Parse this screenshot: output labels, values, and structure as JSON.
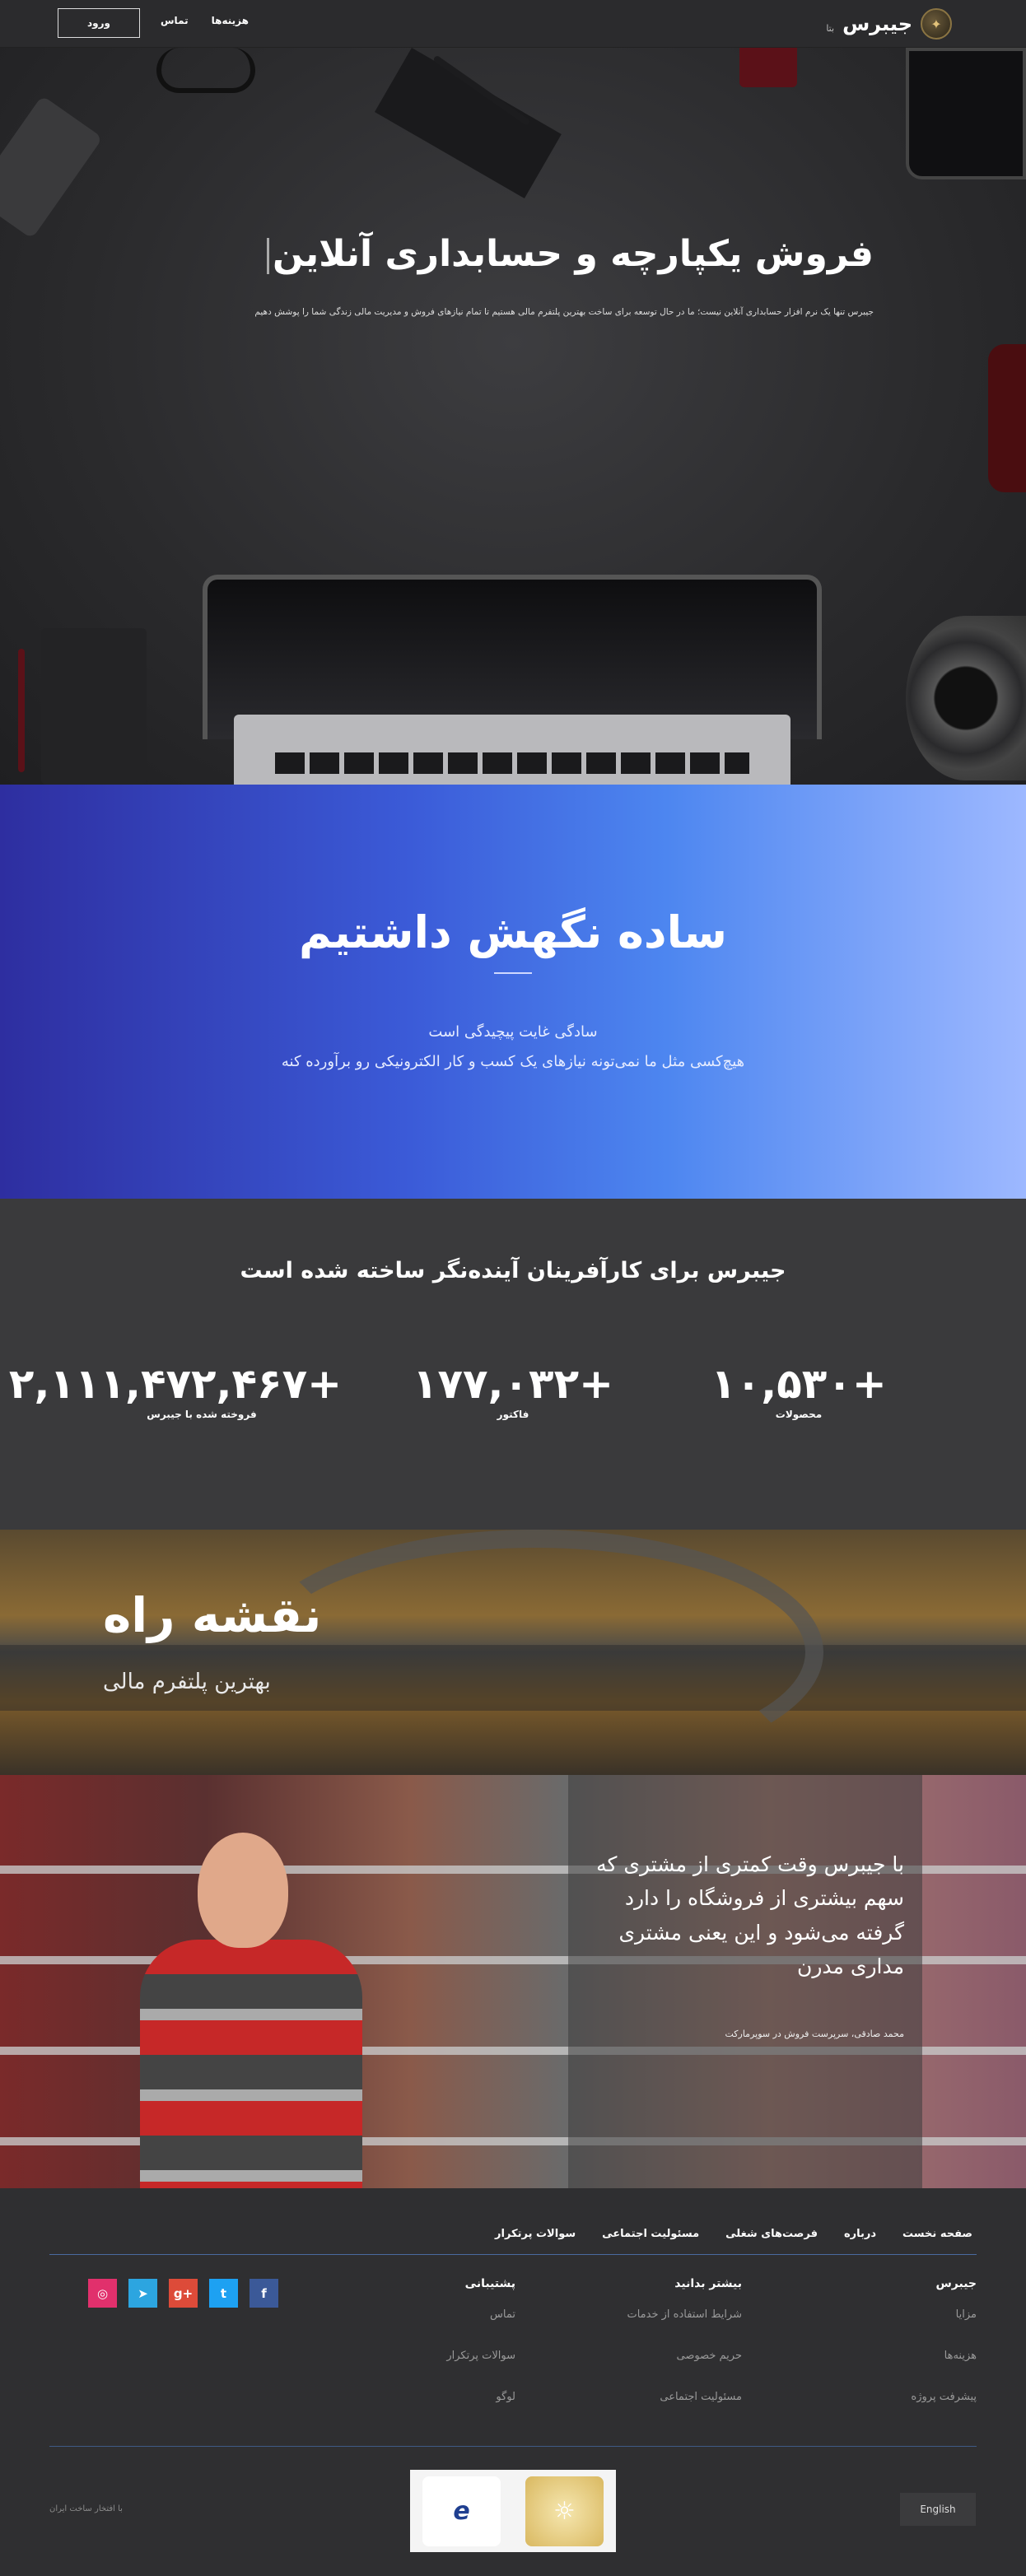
{
  "navbar": {
    "brand_name": "جیبرس",
    "brand_beta": "بتا",
    "links": [
      "هزینه‌ها",
      "تماس"
    ],
    "login_label": "ورود"
  },
  "hero": {
    "title": "فروش یکپارچه و حسابداری آنلاین",
    "subtitle": "جیبرس تنها یک نرم افزار حسابداری آنلاین نیست؛ ما در حال توسعه برای ساخت بهترین پلتفرم مالی هستیم تا تمام نیازهای فروش و مدیریت مالی زندگی شما را پوشش دهیم"
  },
  "simplicity": {
    "title": "ساده نگهش داشتیم",
    "line1": "سادگی غایت پیچیدگی است",
    "line2": "هیچ‌کسی مثل ما نمی‌تونه نیازهای یک کسب و کار الکترونیکی رو برآورده کنه"
  },
  "stats": {
    "title": "جیبرس برای کارآفرینان آینده‌نگر ساخته شده است",
    "items": [
      {
        "value": "+۱۰,۵۳۰",
        "label": "محصولات"
      },
      {
        "value": "+۱۷۷,۰۳۲",
        "label": "فاکتور"
      },
      {
        "value": "+۲,۱۱۱,۴۷۲,۴۶۷",
        "label": "فروخته شده با جیبرس"
      }
    ]
  },
  "roadmap": {
    "title": "نقشه راه",
    "subtitle": "بهترین پلتفرم مالی"
  },
  "testimonial": {
    "quote": "با جیبرس وقت کمتری از مشتری که سهم بیشتری از فروشگاه را دارد گرفته می‌شود و این یعنی مشتری مداری مدرن",
    "author": "محمد صادقی، سرپرست فروش در سوپرمارکت"
  },
  "footer": {
    "top_links": [
      "صفحه نخست",
      "درباره",
      "فرصت‌های شغلی",
      "مسئولیت اجتماعی",
      "سوالات پرتکرار"
    ],
    "columns": [
      {
        "title": "جیبرس",
        "items": [
          "مزایا",
          "هزینه‌ها",
          "پیشرفت پروژه"
        ]
      },
      {
        "title": "بیشتر بدانید",
        "items": [
          "شرایط استفاده از خدمات",
          "حریم خصوصی",
          "مسئولیت اجتماعی"
        ]
      },
      {
        "title": "پشتیبانی",
        "items": [
          "تماس",
          "سوالات پرتکرار",
          "لوگو"
        ]
      }
    ],
    "socials": [
      "facebook-icon",
      "twitter-icon",
      "google-plus-icon",
      "telegram-icon",
      "instagram-icon"
    ],
    "social_colors": [
      "#3b5998",
      "#1da1f2",
      "#dd4b39",
      "#2ca5e0",
      "#e1306c"
    ],
    "language_label": "English",
    "copyright": "با افتخار ساخت ایران"
  }
}
